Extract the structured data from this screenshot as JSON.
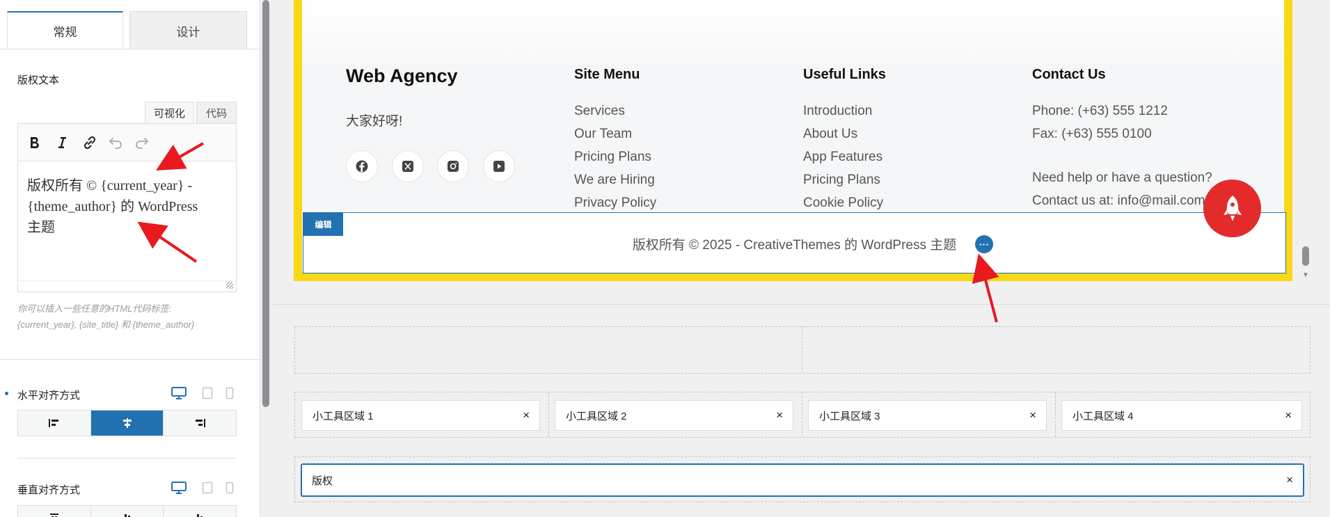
{
  "tabs": {
    "general": "常规",
    "design": "设计"
  },
  "copyright_field": {
    "label": "版权文本",
    "mode_visual": "可视化",
    "mode_code": "代码",
    "content_line1": "版权所有 © {current_year} -",
    "content_line2": "{theme_author} 的 WordPress",
    "content_line3": "主题",
    "hint_line1": "你可以插入一些任意的HTML代码标签:",
    "hint_line2": "{current_year}, {site_title} 和 {theme_author}"
  },
  "horizontal_align": {
    "label": "水平对齐方式",
    "selected": "center"
  },
  "vertical_align": {
    "label": "垂直对齐方式"
  },
  "site": {
    "brand": "Web Agency",
    "greeting": "大家好呀!",
    "socials": [
      "facebook-icon",
      "x-icon",
      "instagram-icon",
      "youtube-icon"
    ],
    "columns": [
      {
        "title": "Site Menu",
        "items": [
          "Services",
          "Our Team",
          "Pricing Plans",
          "We are Hiring",
          "Privacy Policy"
        ]
      },
      {
        "title": "Useful Links",
        "items": [
          "Introduction",
          "About Us",
          "App Features",
          "Pricing Plans",
          "Cookie Policy"
        ]
      }
    ],
    "contact": {
      "title": "Contact Us",
      "phone": "Phone: (+63) 555 1212",
      "fax": "Fax: (+63) 555 0100",
      "question": "Need help or have a question?",
      "email": "Contact us at: info@mail.com"
    },
    "edit_tag": "编辑",
    "copyright_text": "版权所有 © 2025 - CreativeThemes 的 WordPress 主题",
    "more_dots": "···"
  },
  "builder": {
    "widgets": [
      "小工具区域 1",
      "小工具区域 2",
      "小工具区域 3",
      "小工具区域 4"
    ],
    "remove": "×",
    "copyright_item": "版权"
  },
  "colors": {
    "accent": "#2271b1",
    "frame": "#f9d816",
    "rocket": "#e32b2b",
    "arrow": "#e8191f"
  }
}
